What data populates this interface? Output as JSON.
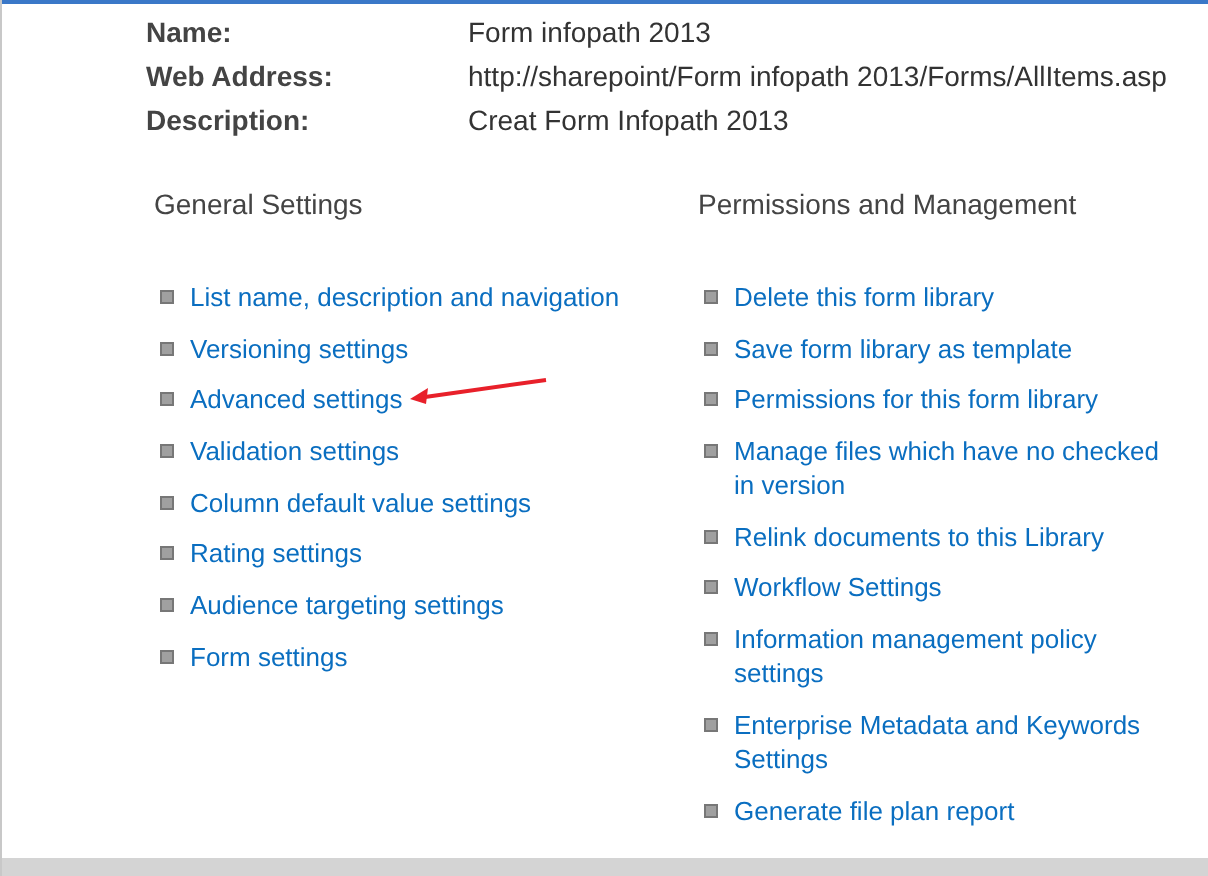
{
  "properties": [
    {
      "label": "Name:",
      "value": "Form infopath 2013"
    },
    {
      "label": "Web Address:",
      "value": "http://sharepoint/Form infopath 2013/Forms/AllItems.asp"
    },
    {
      "label": "Description:",
      "value": "Creat Form Infopath 2013"
    }
  ],
  "sections": [
    {
      "heading": "General Settings",
      "links": [
        {
          "text": "List name, description and navigation",
          "highlighted": false
        },
        {
          "text": "Versioning settings",
          "highlighted": false
        },
        {
          "text": "Advanced settings",
          "highlighted": true
        },
        {
          "text": "Validation settings",
          "highlighted": false
        },
        {
          "text": "Column default value settings",
          "highlighted": false
        },
        {
          "text": "Rating settings",
          "highlighted": false
        },
        {
          "text": "Audience targeting settings",
          "highlighted": false
        },
        {
          "text": "Form settings",
          "highlighted": false
        }
      ]
    },
    {
      "heading": "Permissions and Management",
      "links": [
        {
          "text": "Delete this form library",
          "highlighted": false
        },
        {
          "text": "Save form library as template",
          "highlighted": false
        },
        {
          "text": "Permissions for this form library",
          "highlighted": false
        },
        {
          "text": "Manage files which have no checked in version",
          "highlighted": false
        },
        {
          "text": "Relink documents to this Library",
          "highlighted": false
        },
        {
          "text": "Workflow Settings",
          "highlighted": false
        },
        {
          "text": "Information management policy settings",
          "highlighted": false
        },
        {
          "text": "Enterprise Metadata and Keywords Settings",
          "highlighted": false
        },
        {
          "text": "Generate file plan report",
          "highlighted": false
        }
      ]
    }
  ]
}
